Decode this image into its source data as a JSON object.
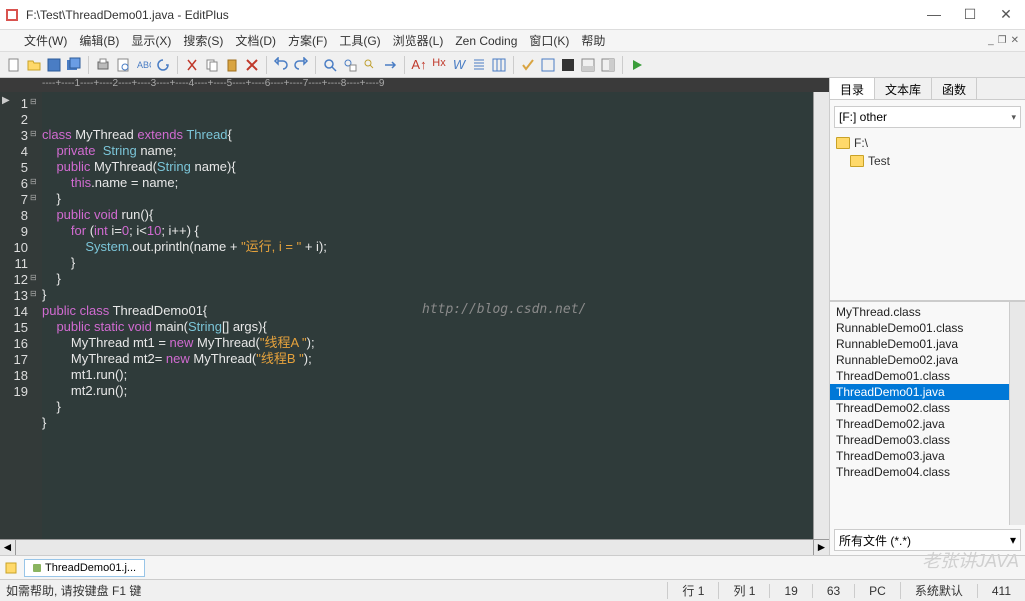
{
  "window": {
    "title": "F:\\Test\\ThreadDemo01.java - EditPlus"
  },
  "menus": {
    "file": "文件(W)",
    "edit": "编辑(B)",
    "view": "显示(X)",
    "search": "搜索(S)",
    "doc": "文档(D)",
    "plan": "方案(F)",
    "tools": "工具(G)",
    "browser": "浏览器(L)",
    "zen": "Zen Coding",
    "window": "窗口(K)",
    "help": "帮助"
  },
  "ruler": "----+----1----+----2----+----3----+----4----+----5----+----6----+----7----+----8----+----9",
  "code": {
    "lines": [
      {
        "n": 1,
        "f": "⊟",
        "html": "<span class='kw'>class</span> <span class='pln'>MyThread</span> <span class='kw'>extends</span> <span class='type'>Thread</span><span class='pln'>{</span>"
      },
      {
        "n": 2,
        "f": "",
        "html": "    <span class='kw'>private</span>  <span class='type'>String</span> <span class='pln'>name;</span>"
      },
      {
        "n": 3,
        "f": "⊟",
        "html": "    <span class='kw'>public</span> <span class='pln'>MyThread(</span><span class='type'>String</span> <span class='pln'>name){</span>"
      },
      {
        "n": 4,
        "f": "",
        "html": "        <span class='kw'>this</span><span class='pln'>.name = name;</span>"
      },
      {
        "n": 5,
        "f": "",
        "html": "    <span class='pln'>}</span>"
      },
      {
        "n": 6,
        "f": "⊟",
        "html": "    <span class='kw'>public</span> <span class='kw'>void</span> <span class='pln'>run(){</span>"
      },
      {
        "n": 7,
        "f": "⊟",
        "html": "        <span class='kw'>for</span> <span class='pln'>(</span><span class='kw'>int</span> <span class='pln'>i=</span><span class='num'>0</span><span class='pln'>; i&lt;</span><span class='num'>10</span><span class='pln'>; i++) {</span>"
      },
      {
        "n": 8,
        "f": "",
        "html": "            <span class='type'>System</span><span class='pln'>.out.println(name + </span><span class='str'>\"运行, i = \"</span><span class='pln'> + i);</span>"
      },
      {
        "n": 9,
        "f": "",
        "html": "        <span class='pln'>}</span>"
      },
      {
        "n": 10,
        "f": "",
        "html": "    <span class='pln'>}</span>"
      },
      {
        "n": 11,
        "f": "",
        "html": "<span class='pln'>}</span>"
      },
      {
        "n": 12,
        "f": "⊟",
        "html": "<span class='kw'>public</span> <span class='kw'>class</span> <span class='pln'>ThreadDemo01{</span>"
      },
      {
        "n": 13,
        "f": "⊟",
        "html": "    <span class='kw'>public</span> <span class='kw'>static</span> <span class='kw'>void</span> <span class='pln'>main(</span><span class='type'>String</span><span class='pln'>[] args){</span>"
      },
      {
        "n": 14,
        "f": "",
        "html": "        <span class='pln'>MyThread mt1 = </span><span class='kw'>new</span> <span class='pln'>MyThread(</span><span class='str'>\"线程A \"</span><span class='pln'>);</span>"
      },
      {
        "n": 15,
        "f": "",
        "html": "        <span class='pln'>MyThread mt2= </span><span class='kw'>new</span> <span class='pln'>MyThread(</span><span class='str'>\"线程B \"</span><span class='pln'>);</span>"
      },
      {
        "n": 16,
        "f": "",
        "html": "        <span class='pln'>mt1.run();</span>"
      },
      {
        "n": 17,
        "f": "",
        "html": "        <span class='pln'>mt2.run();</span>"
      },
      {
        "n": 18,
        "f": "",
        "html": "    <span class='pln'>}</span>"
      },
      {
        "n": 19,
        "f": "",
        "html": "<span class='pln'>}</span>"
      }
    ]
  },
  "watermark_url": "http://blog.csdn.net/",
  "side": {
    "tabs": {
      "dir": "目录",
      "lib": "文本库",
      "func": "函数"
    },
    "drive": "[F:] other",
    "folders": [
      "F:\\",
      "Test"
    ],
    "files": [
      "MyThread.class",
      "RunnableDemo01.class",
      "RunnableDemo01.java",
      "RunnableDemo02.java",
      "ThreadDemo01.class",
      "ThreadDemo01.java",
      "ThreadDemo02.class",
      "ThreadDemo02.java",
      "ThreadDemo03.class",
      "ThreadDemo03.java",
      "ThreadDemo04.class"
    ],
    "selected_file": "ThreadDemo01.java",
    "filter": "所有文件 (*.*)"
  },
  "doc_tab": "ThreadDemo01.j...",
  "status": {
    "help": "如需帮助, 请按键盘 F1 键",
    "line": "行 1",
    "col": "列 1",
    "ln_total": "19",
    "chars": "63",
    "enc": "PC",
    "ime": "系统默认",
    "len": "411"
  },
  "overlay": "老张讲JAVA"
}
